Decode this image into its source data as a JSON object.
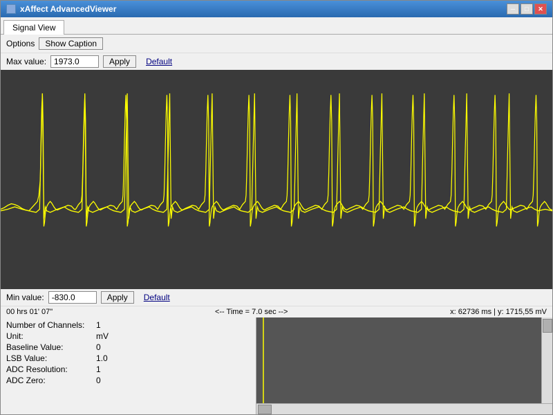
{
  "window": {
    "title": "xAffect AdvancedViewer",
    "icon": "app-icon"
  },
  "title_buttons": {
    "minimize": "─",
    "maximize": "□",
    "close": "✕"
  },
  "tabs": [
    {
      "label": "Signal View",
      "active": true
    }
  ],
  "options": {
    "label": "Options",
    "show_caption_label": "Show Caption"
  },
  "max_value": {
    "label": "Max value:",
    "value": "1973.0",
    "apply_label": "Apply",
    "default_label": "Default"
  },
  "min_value": {
    "label": "Min value:",
    "value": "-830.0",
    "apply_label": "Apply",
    "default_label": "Default"
  },
  "time_bar": {
    "time_elapsed": "00 hrs 01' 07\"",
    "time_marker": "<-- Time = 7.0 sec -->",
    "coordinates": "x: 62736 ms | y: 1715,55 mV"
  },
  "info": {
    "rows": [
      {
        "label": "Number of Channels:",
        "value": "1"
      },
      {
        "label": "Unit:",
        "value": "mV"
      },
      {
        "label": "Baseline Value:",
        "value": "0"
      },
      {
        "label": "LSB Value:",
        "value": "1.0"
      },
      {
        "label": "ADC Resolution:",
        "value": "1"
      },
      {
        "label": "ADC Zero:",
        "value": "0"
      }
    ]
  },
  "colors": {
    "chart_bg": "#3a3a3a",
    "ecg_line": "#ffff00",
    "panel_bg": "#f0f0f0"
  }
}
